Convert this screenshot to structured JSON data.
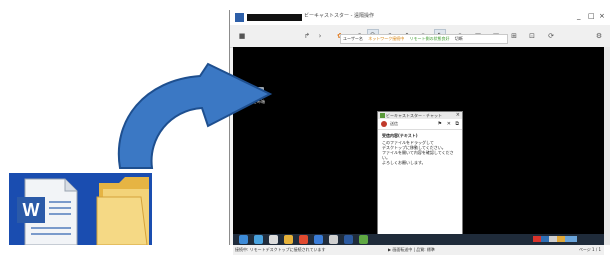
{
  "window": {
    "title": "ビーキャストスター - 遠隔操作",
    "controls": [
      "_",
      "□",
      "×"
    ]
  },
  "toolbar": {
    "buttons": [
      "menu",
      "pointer",
      "expand",
      "tool",
      "undo",
      "redo",
      "draw",
      "upload",
      "mark",
      "cursor",
      "scale",
      "fit",
      "fullscreen",
      "send",
      "capture",
      "settings"
    ],
    "strip": {
      "seg1": "ユーザー名",
      "seg2": "ネットワーク接続中",
      "seg3": "リモート側の状態良好",
      "seg4": "切断"
    }
  },
  "desktop": {
    "recycle_label": "ごみ箱"
  },
  "chat": {
    "title": "ビーキャストスター - チャット",
    "tool_label": "送信",
    "heading": "受信内容(テキスト)",
    "lines": [
      "このファイルをドラッグして",
      "デスクトップに移動してください。",
      "ファイルを開いて内容を確認してください。",
      "よろしくお願いします。"
    ],
    "send_icon": "↵"
  },
  "status_bar": {
    "left": "接続中: リモートデスクトップに接続されています",
    "middle": "▶ 画面転送中 | 品質: 標準",
    "right": "ページ 1 / 1"
  },
  "colors": {
    "remote_screen": "#000000",
    "arrow": "#3b78c4",
    "icon_box": "#1a4db0"
  }
}
